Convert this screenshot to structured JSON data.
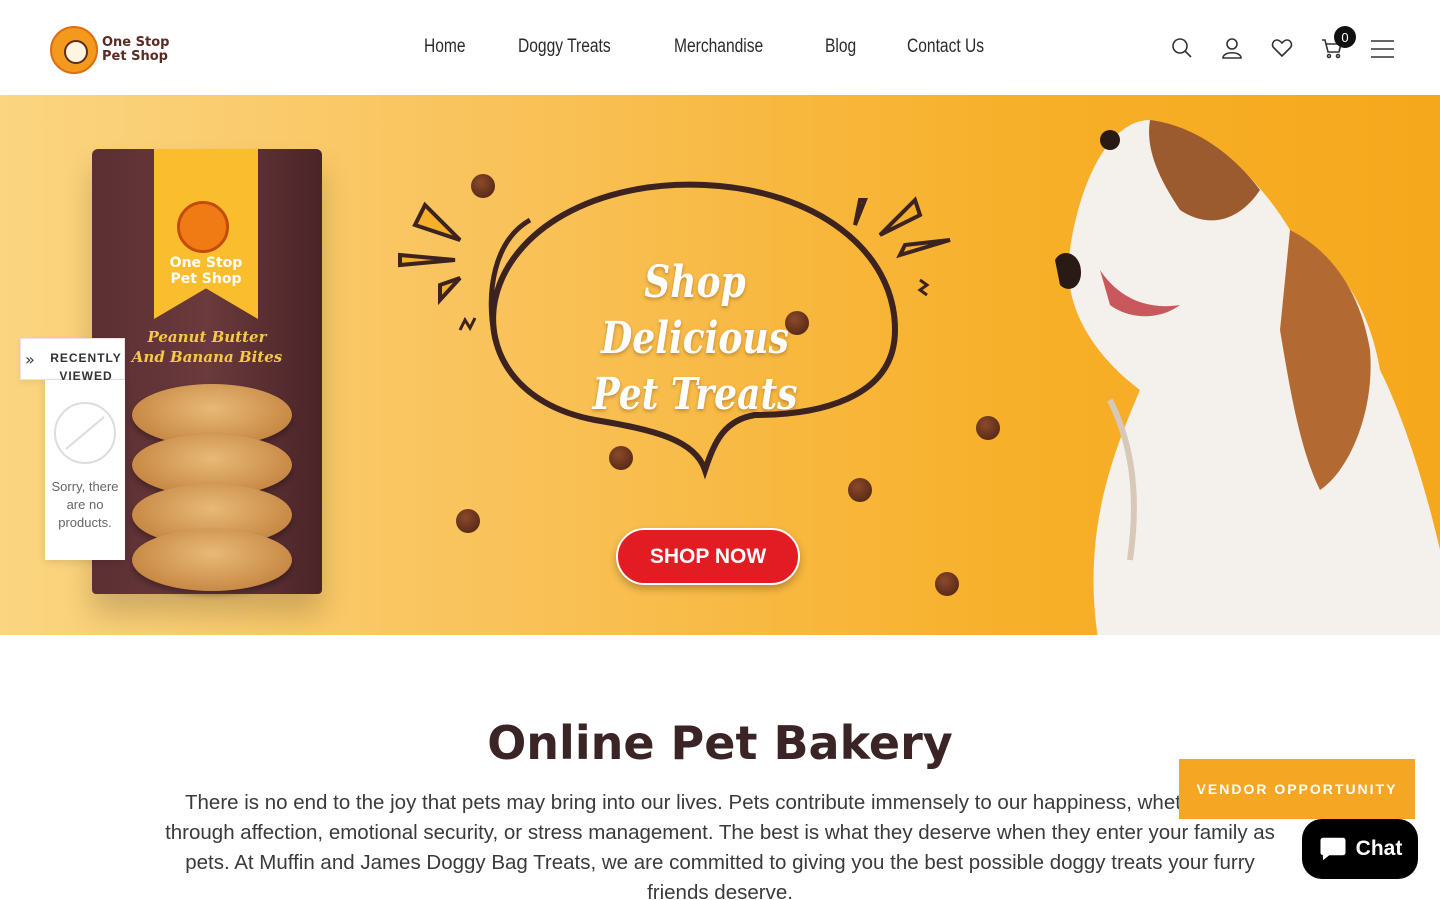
{
  "header": {
    "logo_line1": "One Stop",
    "logo_line2": "Pet Shop",
    "nav": [
      "Home",
      "Doggy Treats",
      "Merchandise",
      "Blog",
      "Contact Us"
    ],
    "cart_count": "0",
    "icons": [
      "search-icon",
      "account-icon",
      "wishlist-icon",
      "cart-icon",
      "menu-icon"
    ]
  },
  "hero": {
    "bag_shop_line1": "One Stop",
    "bag_shop_line2": "Pet Shop",
    "bag_product_line1": "Peanut Butter",
    "bag_product_line2": "And Banana Bites",
    "title_line1": "Shop Delicious",
    "title_line2": "Pet Treats",
    "cta": "SHOP NOW"
  },
  "recently_viewed": {
    "title_line1": "RECENTLY",
    "title_line2": "VIEWED",
    "empty_message": "Sorry, there are no products."
  },
  "intro": {
    "title": "Online Pet Bakery",
    "text": "There is no end to the joy that pets may bring into our lives. Pets contribute immensely to our happiness, whether it be through affection, emotional security, or stress management. The best is what they deserve when they enter your family as pets. At Muffin and James Doggy Bag Treats, we are committed to giving you the best possible doggy treats your furry friends deserve."
  },
  "widgets": {
    "vendor": "VENDOR OPPORTUNITY",
    "chat": "Chat"
  },
  "colors": {
    "accent": "#f5a623",
    "cta_red": "#e31c23",
    "title_brown": "#3b2426"
  }
}
